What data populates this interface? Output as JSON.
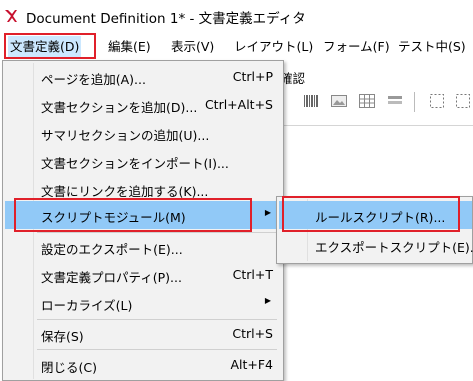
{
  "window": {
    "title": "Document Definition 1* - 文書定義エディタ"
  },
  "menubar": {
    "items": [
      {
        "label": "文書定義(D)"
      },
      {
        "label": "編集(E)"
      },
      {
        "label": "表示(V)"
      },
      {
        "label": "レイアウト(L)"
      },
      {
        "label": "フォーム(F)"
      },
      {
        "label": "テスト中(S)"
      }
    ]
  },
  "background": {
    "confirm_text": "確認"
  },
  "dropdown": {
    "items": [
      {
        "label": "ページを追加(A)...",
        "shortcut": "Ctrl+P"
      },
      {
        "label": "文書セクションを追加(D)...",
        "shortcut": "Ctrl+Alt+S"
      },
      {
        "label": "サマリセクションの追加(U)...",
        "shortcut": ""
      },
      {
        "label": "文書セクションをインポート(I)...",
        "shortcut": ""
      },
      {
        "label": "文書にリンクを追加する(K)...",
        "shortcut": ""
      },
      {
        "label": "スクリプトモジュール(M)",
        "shortcut": ""
      },
      {
        "label": "設定のエクスポート(E)...",
        "shortcut": ""
      },
      {
        "label": "文書定義プロパティ(P)...",
        "shortcut": "Ctrl+T"
      },
      {
        "label": "ローカライズ(L)",
        "shortcut": ""
      },
      {
        "label": "保存(S)",
        "shortcut": "Ctrl+S"
      },
      {
        "label": "閉じる(C)",
        "shortcut": "Alt+F4"
      }
    ]
  },
  "submenu": {
    "items": [
      {
        "label": "ルールスクリプト(R)..."
      },
      {
        "label": "エクスポートスクリプト(E)..."
      }
    ]
  },
  "colors": {
    "highlight_box": "#e0202a",
    "hover": "#91c9f7",
    "menubar_active": "#cce8ff"
  }
}
